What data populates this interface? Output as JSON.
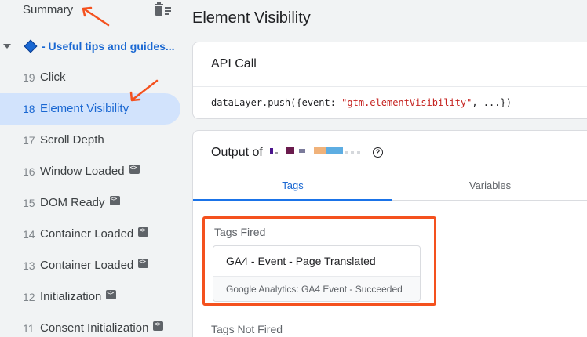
{
  "sidebar": {
    "summary_label": "Summary",
    "group_label": "- Useful tips and guides...",
    "events": [
      {
        "num": "19",
        "name": "Click",
        "code": false,
        "selected": false
      },
      {
        "num": "18",
        "name": "Element Visibility",
        "code": false,
        "selected": true
      },
      {
        "num": "17",
        "name": "Scroll Depth",
        "code": false,
        "selected": false
      },
      {
        "num": "16",
        "name": "Window Loaded",
        "code": true,
        "selected": false
      },
      {
        "num": "15",
        "name": "DOM Ready",
        "code": true,
        "selected": false
      },
      {
        "num": "14",
        "name": "Container Loaded",
        "code": true,
        "selected": false
      },
      {
        "num": "13",
        "name": "Container Loaded",
        "code": true,
        "selected": false
      },
      {
        "num": "12",
        "name": "Initialization",
        "code": true,
        "selected": false
      },
      {
        "num": "11",
        "name": "Consent Initialization",
        "code": true,
        "selected": false
      }
    ]
  },
  "main": {
    "page_title": "Element Visibility",
    "api_call": {
      "title": "API Call",
      "code_prefix": "dataLayer.push({event: ",
      "code_event": "\"gtm.elementVisibility\"",
      "code_suffix": ", ...})"
    },
    "output": {
      "title_prefix": "Output of",
      "help_icon": "?",
      "tabs": [
        {
          "label": "Tags",
          "active": true
        },
        {
          "label": "Variables",
          "active": false
        }
      ],
      "tags_fired_label": "Tags Fired",
      "tags_fired": [
        {
          "name": "GA4 - Event - Page Translated",
          "status": "Google Analytics: GA4 Event - Succeeded"
        }
      ],
      "tags_not_fired_label": "Tags Not Fired"
    }
  },
  "colors": {
    "accent": "#1967d2",
    "selected_bg": "#d2e3fc",
    "annotation": "#f4511e"
  }
}
